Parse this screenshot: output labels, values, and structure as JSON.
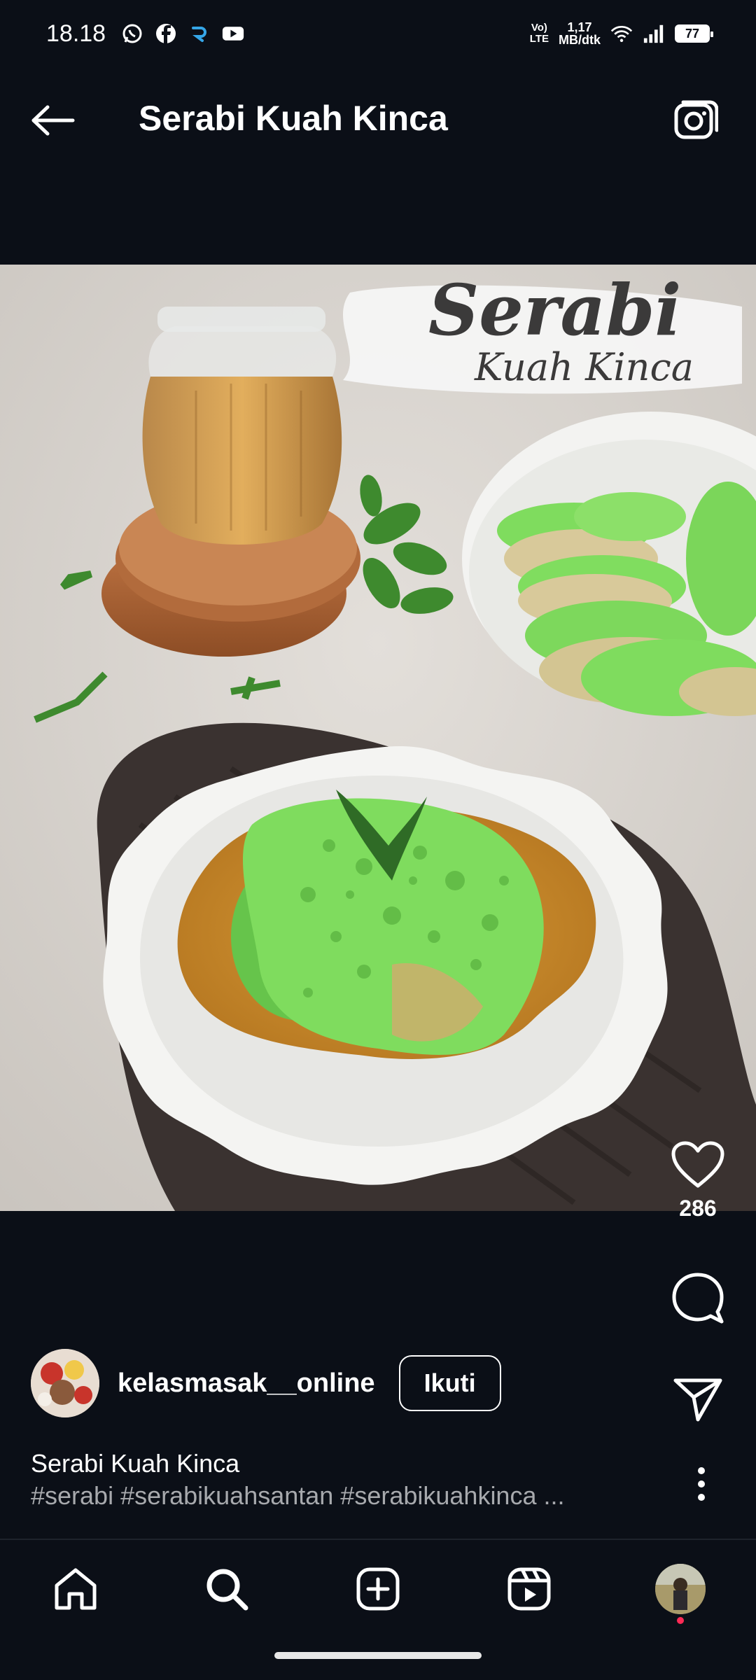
{
  "status_bar": {
    "time": "18.18",
    "volte_top": "Vo)",
    "volte_bottom": "LTE",
    "speed_top": "1,17",
    "speed_bottom": "MB/dtk",
    "battery": "77",
    "app_icons": [
      "whatsapp-icon",
      "facebook-icon",
      "r-app-icon",
      "youtube-icon"
    ]
  },
  "header": {
    "title": "Serabi Kuah Kinca",
    "back_icon": "arrow-left-icon",
    "camera_icon": "camera-icon"
  },
  "post": {
    "overlay_title": "Serabi",
    "overlay_subtitle": "Kuah Kinca",
    "like_count": "286",
    "author": "kelasmasak__online",
    "follow_label": "Ikuti",
    "caption_title": "Serabi Kuah Kinca",
    "caption_tags": "#serabi #serabikuahsantan #serabikuahkinca ..."
  },
  "bottom_nav": {
    "items": [
      "home-icon",
      "search-icon",
      "create-icon",
      "reels-icon",
      "profile-avatar"
    ]
  },
  "colors": {
    "background": "#0b0f17",
    "serabi_green": "#7ed957",
    "kinca_sauce": "#c98a2b",
    "notification_dot": "#ff2a55"
  }
}
